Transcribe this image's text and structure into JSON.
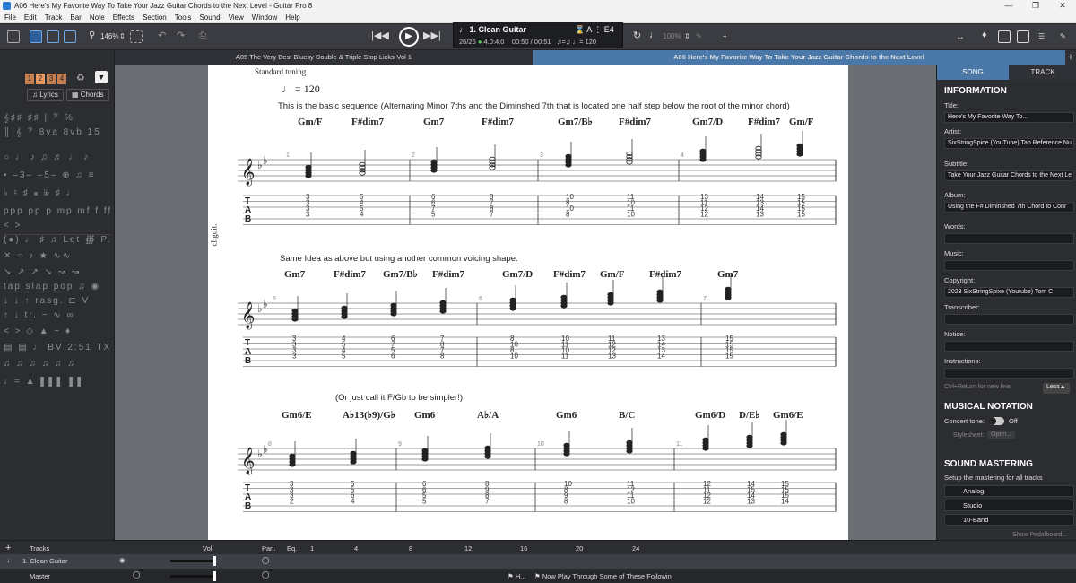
{
  "window": {
    "title": "A06 Here's My Favorite Way To Take Your Jazz Guitar Chords to the Next Level - Guitar Pro 8"
  },
  "menu": [
    "File",
    "Edit",
    "Track",
    "Bar",
    "Note",
    "Effects",
    "Section",
    "Tools",
    "Sound",
    "View",
    "Window",
    "Help"
  ],
  "toolbar": {
    "zoom": "146%",
    "track_name": "1. Clean Guitar",
    "bar_position": "26/26",
    "time_signature": "4.0:4.0",
    "time": "00:50 / 00:51",
    "tempo": "= 120",
    "tuning": "E4",
    "volume": "100%"
  },
  "tabs": {
    "left": "A05 The Very Best Bluesy Double & Triple Stop Licks-Vol 1",
    "right": "A06 Here's My Favorite Way To Take Your Jazz Guitar Chords to the Next Level"
  },
  "palette": {
    "voices": [
      "1",
      "2",
      "3",
      "4"
    ],
    "lyrics": "Lyrics",
    "chords": "Chords"
  },
  "score": {
    "tuning_label": "Standard tuning",
    "tempo_label": "= 120",
    "instrument": "cl.guit.",
    "systems": [
      {
        "text": "This is the basic sequence (Alternating Minor 7ths and the Diminshed 7th that is located one half step below the root of the minor chord)",
        "chords": [
          "Gm/F",
          "F#dim7",
          "Gm7",
          "F#dim7",
          "Gm7/B♭",
          "F#dim7",
          "Gm7/D",
          "F#dim7",
          "Gm/F"
        ],
        "bar_numbers": [
          "1",
          "2",
          "3",
          "4"
        ],
        "tabs": [
          [
            "3",
            "3",
            "3",
            "3"
          ],
          [
            "5",
            "4",
            "5",
            "4"
          ],
          [
            "6",
            "6",
            "7",
            "5"
          ],
          [
            "8",
            "7",
            "8",
            "7"
          ],
          [
            "10",
            "8",
            "10",
            "8"
          ],
          [
            "11",
            "10",
            "11",
            "10"
          ],
          [
            "13",
            "11",
            "12",
            "12"
          ],
          [
            "14",
            "13",
            "14",
            "13"
          ],
          [
            "15",
            "15",
            "15",
            "15"
          ]
        ]
      },
      {
        "text": "Same Idea as above but using another common voicing shape.",
        "chords": [
          "Gm7",
          "F#dim7",
          "Gm7/B♭",
          "F#dim7",
          "Gm7/D",
          "F#dim7",
          "Gm/F",
          "F#dim7",
          "Gm7"
        ],
        "bar_numbers": [
          "5",
          "6",
          "7"
        ],
        "tabs": [
          [
            "3",
            "3",
            "3",
            "3"
          ],
          [
            "4",
            "5",
            "4",
            "5"
          ],
          [
            "6",
            "7",
            "5",
            "6"
          ],
          [
            "7",
            "8",
            "7",
            "8"
          ],
          [
            "8",
            "10",
            "8",
            "10"
          ],
          [
            "10",
            "11",
            "10",
            "11"
          ],
          [
            "11",
            "12",
            "12",
            "13"
          ],
          [
            "13",
            "14",
            "13",
            "14"
          ],
          [
            "15",
            "15",
            "15",
            "15"
          ]
        ]
      },
      {
        "text": "(Or just call it  F/Gb to be simpler!)",
        "chords": [
          "Gm6/E",
          "A♭13(♭9)/G♭",
          "Gm6",
          "A♭/A",
          "Gm6",
          "B/C",
          "Gm6/D",
          "D/E♭",
          "Gm6/E"
        ],
        "bar_numbers": [
          "8",
          "9",
          "10",
          "11"
        ],
        "tabs": [
          [
            "3",
            "3",
            "3",
            "2"
          ],
          [
            "5",
            "5",
            "6",
            "4"
          ],
          [
            "6",
            "6",
            "5",
            "5"
          ],
          [
            "8",
            "9",
            "8",
            "7"
          ],
          [
            "10",
            "8",
            "9",
            "8"
          ],
          [
            "11",
            "12",
            "11",
            "10"
          ],
          [
            "12",
            "11",
            "12",
            "12"
          ],
          [
            "14",
            "15",
            "14",
            "13"
          ],
          [
            "15",
            "15",
            "15",
            "14"
          ]
        ]
      }
    ]
  },
  "panel": {
    "tab_song": "SONG",
    "tab_track": "TRACK",
    "information": "INFORMATION",
    "fields": [
      {
        "label": "Title:",
        "value": "Here's My Favorite Way To..."
      },
      {
        "label": "Artist:",
        "value": "SixStringSpice (YouTube) Tab Reference Nu"
      },
      {
        "label": "Subtitle:",
        "value": "Take Your Jazz Guitar Chords to the Next Le"
      },
      {
        "label": "Album:",
        "value": "Using the F# Diminshed 7th Chord to Conr"
      },
      {
        "label": "Words:",
        "value": ""
      },
      {
        "label": "Music:",
        "value": ""
      },
      {
        "label": "Copyright:",
        "value": "2023 SixStringSpixe (Youtube) Tom C"
      },
      {
        "label": "Transcriber:",
        "value": ""
      },
      {
        "label": "Notice:",
        "value": ""
      },
      {
        "label": "Instructions:",
        "value": ""
      }
    ],
    "hint": "Ctrl+Return for new line.",
    "less": "Less",
    "musical_notation": "MUSICAL NOTATION",
    "concert_tone": "Concert tone:",
    "concert_off": "Off",
    "stylesheet": "Stylesheet:",
    "open": "Open...",
    "sound_mastering": "SOUND MASTERING",
    "mastering_desc": "Setup the mastering for all tracks",
    "mastering": [
      "Analog",
      "Studio",
      "10-Band"
    ],
    "show_pedalboard": "Show Pedalboard..."
  },
  "bottom": {
    "tracks": "Tracks",
    "vol": "Vol.",
    "pan": "Pan.",
    "eq": "Eq.",
    "timeline": [
      "1",
      "4",
      "8",
      "12",
      "16",
      "20",
      "24"
    ],
    "track1": "1. Clean Guitar",
    "master": "Master",
    "section1": "H...",
    "section2": "Now Play Through Some of These Followin"
  }
}
